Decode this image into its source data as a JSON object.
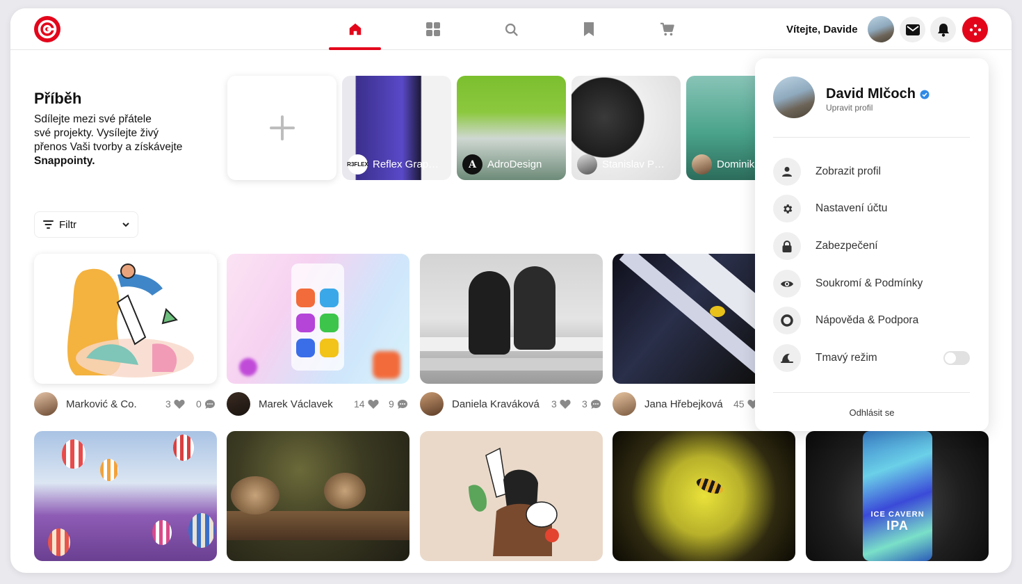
{
  "header": {
    "welcome": "Vítejte, Davide",
    "nav_icons": [
      "home-icon",
      "grid-icon",
      "search-icon",
      "bookmark-icon",
      "cart-icon"
    ],
    "action_icons": [
      "mail-icon",
      "bell-icon",
      "apps-dots-icon"
    ],
    "accent_color": "#e3061b"
  },
  "stories": {
    "title": "Příběh",
    "desc_line1": "Sdílejte mezi své přátele",
    "desc_line2": "své projekty. Vysílejte živý",
    "desc_line3": "přenos Vaši tvorby a získávejte",
    "desc_line4": "Snappointy.",
    "items": [
      {
        "label": "Reflex Grap…",
        "avatar_text": "R3FLEX"
      },
      {
        "label": "AdroDesign",
        "avatar_text": "A"
      },
      {
        "label": "Stanislav P…",
        "avatar_text": ""
      },
      {
        "label": "Dominik",
        "avatar_text": ""
      }
    ]
  },
  "filter": {
    "label": "Filtr"
  },
  "posts": [
    {
      "author": "Marković & Co.",
      "likes": "3",
      "comments": "0"
    },
    {
      "author": "Marek Václavek",
      "likes": "14",
      "comments": "9"
    },
    {
      "author": "Daniela Kraváková",
      "likes": "3",
      "comments": "3"
    },
    {
      "author": "Jana Hřebejková",
      "likes": "45",
      "comments": ""
    }
  ],
  "dropdown": {
    "name": "David Mlčoch",
    "edit": "Upravit profil",
    "items": [
      {
        "label": "Zobrazit profil",
        "icon": "person-icon"
      },
      {
        "label": "Nastavení účtu",
        "icon": "gear-icon"
      },
      {
        "label": "Zabezpečení",
        "icon": "lock-icon"
      },
      {
        "label": "Soukromí & Podmínky",
        "icon": "eye-icon"
      },
      {
        "label": "Nápověda & Podpora",
        "icon": "lifebuoy-icon"
      },
      {
        "label": "Tmavý režim",
        "icon": "moon-icon"
      }
    ],
    "dark_mode": false,
    "logout": "Odhlásit se"
  }
}
